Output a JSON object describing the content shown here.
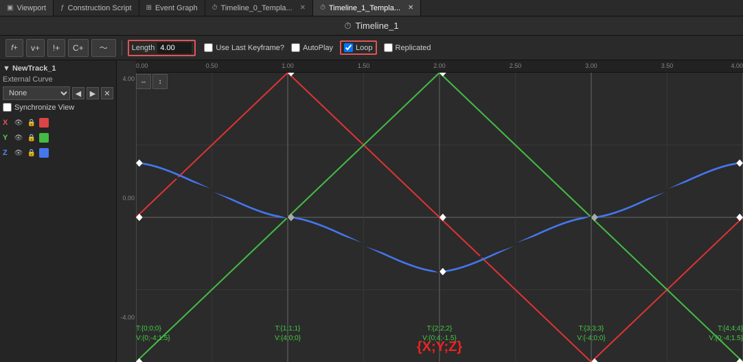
{
  "tabs": [
    {
      "id": "viewport",
      "label": "Viewport",
      "icon": "▣",
      "active": false,
      "closeable": false
    },
    {
      "id": "construction-script",
      "label": "Construction Script",
      "icon": "ƒ",
      "active": false,
      "closeable": false
    },
    {
      "id": "event-graph",
      "label": "Event Graph",
      "icon": "⊞",
      "active": false,
      "closeable": false
    },
    {
      "id": "timeline0",
      "label": "Timeline_0_Templa...",
      "icon": "⏱",
      "active": false,
      "closeable": true
    },
    {
      "id": "timeline1",
      "label": "Timeline_1_Templa...",
      "icon": "⏱",
      "active": true,
      "closeable": true
    }
  ],
  "title": {
    "icon": "⏱",
    "text": "Timeline_1"
  },
  "toolbar": {
    "buttons": [
      {
        "id": "add-float",
        "label": "f+"
      },
      {
        "id": "add-vector",
        "label": "v+"
      },
      {
        "id": "add-event",
        "label": "!+"
      },
      {
        "id": "add-color",
        "label": "C+"
      }
    ],
    "length_label": "Length",
    "length_value": "4.00",
    "use_last_keyframe_label": "Use Last Keyframe?",
    "autoplay_label": "AutoPlay",
    "loop_label": "Loop",
    "replicated_label": "Replicated"
  },
  "left_panel": {
    "track_name": "▼ NewTrack_1",
    "external_curve_label": "External Curve",
    "curve_options": [
      "None"
    ],
    "curve_selected": "None",
    "synchronize_label": "Synchronize View",
    "channels": [
      {
        "label": "X",
        "color": "#dd4444"
      },
      {
        "label": "Y",
        "color": "#44bb44"
      },
      {
        "label": "Z",
        "color": "#4477ee"
      }
    ]
  },
  "ruler": {
    "ticks": [
      {
        "value": "0.00",
        "pct": 0
      },
      {
        "value": "0.50",
        "pct": 12.5
      },
      {
        "value": "1.00",
        "pct": 25
      },
      {
        "value": "1.50",
        "pct": 37.5
      },
      {
        "value": "2.00",
        "pct": 50
      },
      {
        "value": "2.50",
        "pct": 62.5
      },
      {
        "value": "3.00",
        "pct": 75
      },
      {
        "value": "3.50",
        "pct": 87.5
      },
      {
        "value": "4.00",
        "pct": 100
      }
    ]
  },
  "value_labels": [
    "4.00",
    "0.00",
    "-4.00"
  ],
  "keyframes": [
    {
      "time": "T:{0;0;0}",
      "value": "V:{0;-4;1.5}",
      "xpct": 0
    },
    {
      "time": "T:{1;1;1}",
      "value": "V:{4;0;0}",
      "xpct": 25
    },
    {
      "time": "T:{2;2;2}",
      "value": "V:{0;4;-1.5}",
      "xpct": 50
    },
    {
      "time": "T:{3;3;3}",
      "value": "V:{-4;0;0}",
      "xpct": 75
    },
    {
      "time": "T:{4;4;4}",
      "value": "V:{0;-4;1.5}",
      "xpct": 100
    }
  ],
  "xyz_label": "{X;Y;Z}",
  "colors": {
    "red": "#dd3333",
    "green": "#44bb44",
    "blue": "#4477ee",
    "accent_border": "#e05555"
  }
}
